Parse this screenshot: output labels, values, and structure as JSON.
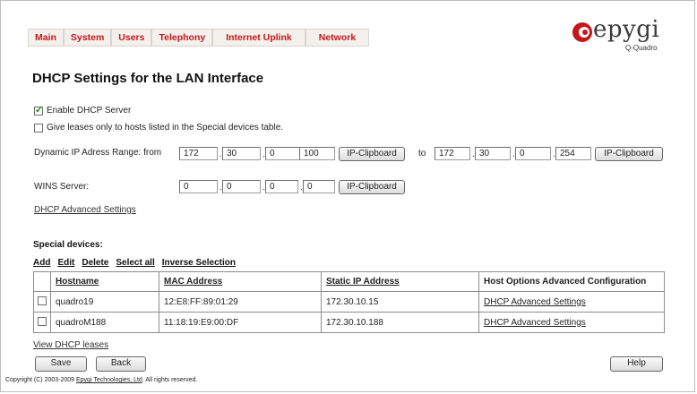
{
  "nav": {
    "items": [
      "Main",
      "System",
      "Users",
      "Telephony",
      "Internet Uplink",
      "Network"
    ]
  },
  "logo": {
    "brand": "epygi",
    "model": "Q-Quadro"
  },
  "page": {
    "title": "DHCP Settings for the LAN Interface"
  },
  "options": {
    "enable_dhcp": "Enable DHCP Server",
    "leases_only": "Give leases only to hosts listed in the Special devices table."
  },
  "range": {
    "label": "Dynamic IP Adress Range: from",
    "from": [
      "172",
      "30",
      "0",
      "100"
    ],
    "to_label": "to",
    "to": [
      "172",
      "30",
      "0",
      "254"
    ],
    "clip_label": "IP-Clipboard"
  },
  "wins": {
    "label": "WINS Server:",
    "values": [
      "0",
      "0",
      "0",
      "0"
    ],
    "clip_label": "IP-Clipboard"
  },
  "advanced_link": "DHCP Advanced Settings",
  "special": {
    "title": "Special devices:",
    "actions": [
      "Add",
      "Edit",
      "Delete",
      "Select all",
      "Inverse Selection"
    ],
    "headers": [
      "Hostname",
      "MAC Address",
      "Static IP Address",
      "Host Options Advanced Configuration"
    ],
    "rows": [
      {
        "host": "quadro19",
        "mac": "12:E8:FF:89:01:29",
        "ip": "172.30.10.15",
        "adv": "DHCP Advanced Settings"
      },
      {
        "host": "quadroM188",
        "mac": "11:18:19:E9:00:DF",
        "ip": "172.30.10.188",
        "adv": "DHCP Advanced Settings"
      }
    ]
  },
  "view_leases": "View DHCP leases",
  "buttons": {
    "save": "Save",
    "back": "Back",
    "help": "Help"
  },
  "footer": {
    "prefix": "Copyright (C) 2003-2009",
    "company": "Epygi Technologies, Ltd",
    "suffix": ". All rights reserved."
  }
}
